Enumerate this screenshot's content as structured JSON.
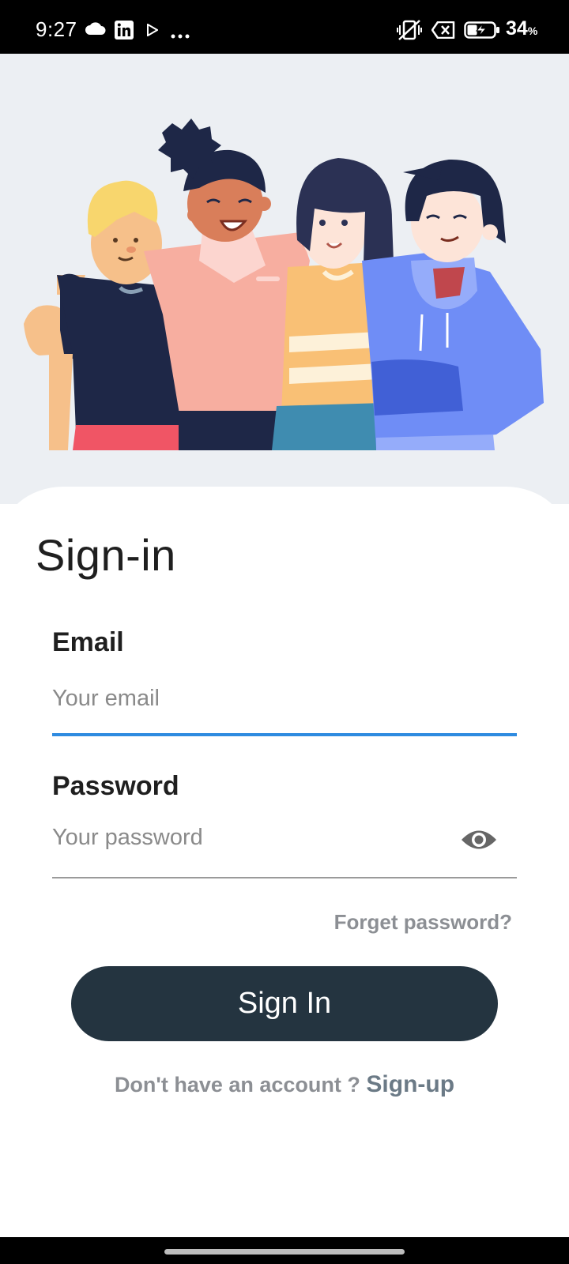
{
  "status_bar": {
    "time": "9:27",
    "battery_percent": "34",
    "battery_unit": "%",
    "left_icons": [
      "cloud-icon",
      "linkedin-icon",
      "play-icon",
      "more-dots-icon"
    ],
    "right_icons": [
      "vibrate-off-icon",
      "no-sim-icon",
      "battery-charging-icon"
    ]
  },
  "hero": {
    "illustration": "group-of-friends-illustration",
    "background_color": "#eceff3"
  },
  "form": {
    "title": "Sign-in",
    "email": {
      "label": "Email",
      "placeholder": "Your email",
      "value": ""
    },
    "password": {
      "label": "Password",
      "placeholder": "Your password",
      "value": "",
      "toggle_icon": "eye-icon"
    },
    "forgot_password": "Forget password?",
    "submit_label": "Sign In",
    "signup_prompt": "Don't have an account ?",
    "signup_link": "Sign-up"
  },
  "colors": {
    "accent": "#2e8be0",
    "button": "#243440",
    "muted_text": "#8c8f94"
  }
}
